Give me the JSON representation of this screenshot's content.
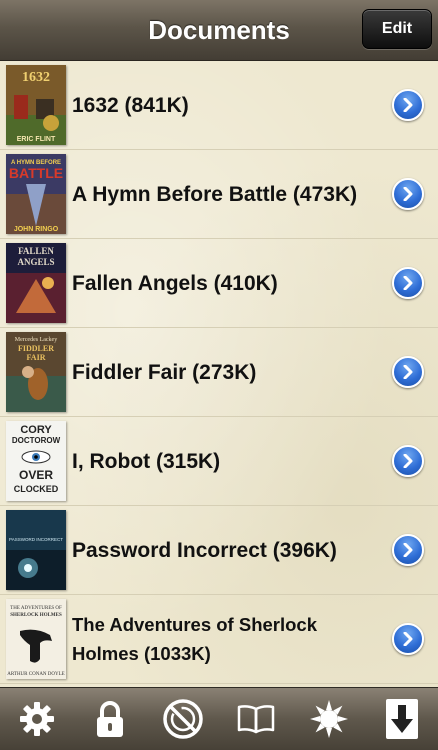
{
  "navbar": {
    "title": "Documents",
    "edit_label": "Edit"
  },
  "documents": [
    {
      "title": "1632 (841K)",
      "cover": {
        "lines": [
          "1632",
          "ERIC FLINT"
        ],
        "bg": "#7a5a2a"
      }
    },
    {
      "title": "A Hymn Before Battle (473K)",
      "cover": {
        "lines": [
          "A HYMN BEFORE",
          "BATTLE",
          "JOHN RINGO"
        ],
        "bg": "#3b3a64"
      }
    },
    {
      "title": "Fallen Angels (410K)",
      "cover": {
        "lines": [
          "FALLEN",
          "ANGELS"
        ],
        "bg": "#1d1d3a"
      }
    },
    {
      "title": "Fiddler Fair (273K)",
      "cover": {
        "lines": [
          "Mercedes Lackey",
          "FIDDLER",
          "FAIR"
        ],
        "bg": "#5a4730"
      }
    },
    {
      "title": "I, Robot (315K)",
      "cover": {
        "lines": [
          "CORY",
          "DOCTOROW",
          "OVER",
          "CLOCKED"
        ],
        "bg": "#f4f4f0"
      }
    },
    {
      "title": "Password Incorrect (396K)",
      "cover": {
        "lines": [
          "PASSWORD INCORRECT"
        ],
        "bg": "#0d1e2a"
      }
    },
    {
      "title": "The Adventures of Sherlock Holmes (1033K)",
      "cover": {
        "lines": [
          "THE ADVENTURES OF",
          "SHERLOCK HOLMES",
          "ARTHUR CONAN DOYLE"
        ],
        "bg": "#f3efe3"
      }
    }
  ],
  "toolbar": {
    "items": [
      {
        "icon": "gear-icon"
      },
      {
        "icon": "lock-icon"
      },
      {
        "icon": "no-rotation-icon"
      },
      {
        "icon": "book-icon"
      },
      {
        "icon": "brightness-icon"
      },
      {
        "icon": "download-icon"
      }
    ]
  },
  "colors": {
    "disclosure": "#2f6ed6",
    "navbar": "#5c5549",
    "background": "#eee8d0"
  }
}
